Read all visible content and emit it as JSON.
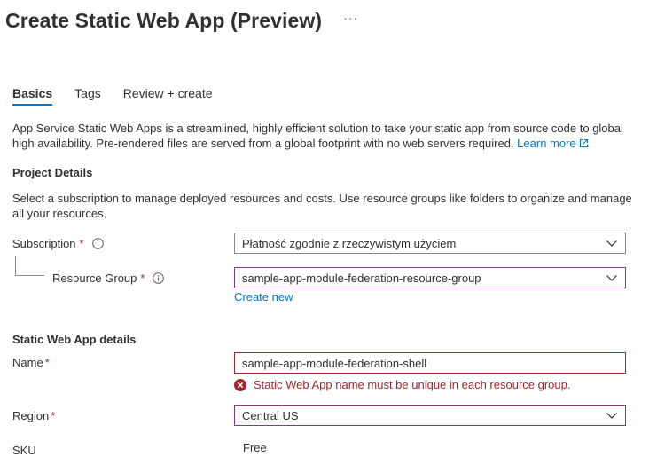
{
  "header": {
    "title": "Create Static Web App (Preview)",
    "more_label": "···"
  },
  "tabs": [
    {
      "label": "Basics",
      "active": true
    },
    {
      "label": "Tags",
      "active": false
    },
    {
      "label": "Review + create",
      "active": false
    }
  ],
  "intro": {
    "text": "App Service Static Web Apps is a streamlined, highly efficient solution to take your static app from source code to global high availability. Pre-rendered files are served from a global footprint with no web servers required.",
    "learn_more": "Learn more"
  },
  "project_details": {
    "heading": "Project Details",
    "description": "Select a subscription to manage deployed resources and costs. Use resource groups like folders to organize and manage all your resources.",
    "subscription": {
      "label": "Subscription",
      "required_mark": "*",
      "value": "Płatność zgodnie z rzeczywistym użyciem"
    },
    "resource_group": {
      "label": "Resource Group",
      "required_mark": "*",
      "value": "sample-app-module-federation-resource-group",
      "create_new": "Create new"
    }
  },
  "app_details": {
    "heading": "Static Web App details",
    "name": {
      "label": "Name",
      "required_mark": "*",
      "value": "sample-app-module-federation-shell",
      "error": "Static Web App name must be unique in each resource group."
    },
    "region": {
      "label": "Region",
      "required_mark": "*",
      "value": "Central US"
    },
    "sku": {
      "label": "SKU",
      "value": "Free"
    }
  },
  "colors": {
    "accent": "#0078d4",
    "error": "#a4262c",
    "highlight_border": "#8b3a8b",
    "text": "#323130"
  }
}
